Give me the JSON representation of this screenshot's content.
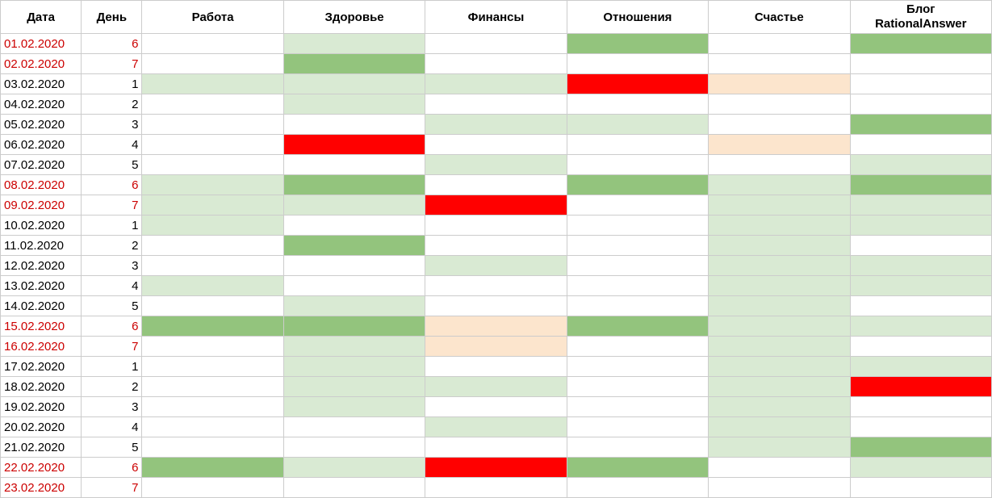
{
  "headers": [
    "Дата",
    "День",
    "Работа",
    "Здоровье",
    "Финансы",
    "Отношения",
    "Счастье",
    "Блог RationalAnswer"
  ],
  "colors": {
    "b": "#ffffff",
    "lg": "#d9ead3",
    "g": "#93c47d",
    "r": "#ff0000",
    "p": "#fce5cd"
  },
  "rows": [
    {
      "date": "01.02.2020",
      "day": "6",
      "weekend": true,
      "cells": [
        "b",
        "lg",
        "b",
        "g",
        "b",
        "g"
      ]
    },
    {
      "date": "02.02.2020",
      "day": "7",
      "weekend": true,
      "cells": [
        "b",
        "g",
        "b",
        "b",
        "b",
        "b"
      ]
    },
    {
      "date": "03.02.2020",
      "day": "1",
      "weekend": false,
      "cells": [
        "lg",
        "lg",
        "lg",
        "r",
        "p",
        "b"
      ]
    },
    {
      "date": "04.02.2020",
      "day": "2",
      "weekend": false,
      "cells": [
        "b",
        "lg",
        "b",
        "b",
        "b",
        "b"
      ]
    },
    {
      "date": "05.02.2020",
      "day": "3",
      "weekend": false,
      "cells": [
        "b",
        "b",
        "lg",
        "lg",
        "b",
        "g"
      ]
    },
    {
      "date": "06.02.2020",
      "day": "4",
      "weekend": false,
      "cells": [
        "b",
        "r",
        "b",
        "b",
        "p",
        "b"
      ]
    },
    {
      "date": "07.02.2020",
      "day": "5",
      "weekend": false,
      "cells": [
        "b",
        "b",
        "lg",
        "b",
        "b",
        "lg"
      ]
    },
    {
      "date": "08.02.2020",
      "day": "6",
      "weekend": true,
      "cells": [
        "lg",
        "g",
        "b",
        "g",
        "lg",
        "g"
      ]
    },
    {
      "date": "09.02.2020",
      "day": "7",
      "weekend": true,
      "cells": [
        "lg",
        "lg",
        "r",
        "b",
        "lg",
        "lg"
      ]
    },
    {
      "date": "10.02.2020",
      "day": "1",
      "weekend": false,
      "cells": [
        "lg",
        "b",
        "b",
        "b",
        "lg",
        "lg"
      ]
    },
    {
      "date": "11.02.2020",
      "day": "2",
      "weekend": false,
      "cells": [
        "b",
        "g",
        "b",
        "b",
        "lg",
        "b"
      ]
    },
    {
      "date": "12.02.2020",
      "day": "3",
      "weekend": false,
      "cells": [
        "b",
        "b",
        "lg",
        "b",
        "lg",
        "lg"
      ]
    },
    {
      "date": "13.02.2020",
      "day": "4",
      "weekend": false,
      "cells": [
        "lg",
        "b",
        "b",
        "b",
        "lg",
        "lg"
      ]
    },
    {
      "date": "14.02.2020",
      "day": "5",
      "weekend": false,
      "cells": [
        "b",
        "lg",
        "b",
        "b",
        "lg",
        "b"
      ]
    },
    {
      "date": "15.02.2020",
      "day": "6",
      "weekend": true,
      "cells": [
        "g",
        "g",
        "p",
        "g",
        "lg",
        "lg"
      ]
    },
    {
      "date": "16.02.2020",
      "day": "7",
      "weekend": true,
      "cells": [
        "b",
        "lg",
        "p",
        "b",
        "lg",
        "b"
      ]
    },
    {
      "date": "17.02.2020",
      "day": "1",
      "weekend": false,
      "cells": [
        "b",
        "lg",
        "b",
        "b",
        "lg",
        "lg"
      ]
    },
    {
      "date": "18.02.2020",
      "day": "2",
      "weekend": false,
      "cells": [
        "b",
        "lg",
        "lg",
        "b",
        "lg",
        "r"
      ]
    },
    {
      "date": "19.02.2020",
      "day": "3",
      "weekend": false,
      "cells": [
        "b",
        "lg",
        "b",
        "b",
        "lg",
        "b"
      ]
    },
    {
      "date": "20.02.2020",
      "day": "4",
      "weekend": false,
      "cells": [
        "b",
        "b",
        "lg",
        "b",
        "lg",
        "b"
      ]
    },
    {
      "date": "21.02.2020",
      "day": "5",
      "weekend": false,
      "cells": [
        "b",
        "b",
        "b",
        "b",
        "lg",
        "g"
      ]
    },
    {
      "date": "22.02.2020",
      "day": "6",
      "weekend": true,
      "cells": [
        "g",
        "lg",
        "r",
        "g",
        "b",
        "lg"
      ]
    },
    {
      "date": "23.02.2020",
      "day": "7",
      "weekend": true,
      "cells": [
        "b",
        "b",
        "b",
        "b",
        "b",
        "b"
      ]
    }
  ]
}
